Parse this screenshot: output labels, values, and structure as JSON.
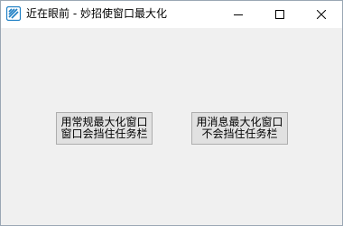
{
  "window": {
    "title": "近在眼前 - 妙招使窗口最大化",
    "app_icon": "app-icon",
    "controls": {
      "minimize_icon": "minimize-icon",
      "maximize_icon": "maximize-icon",
      "close_icon": "close-icon"
    }
  },
  "buttons": {
    "normal_maximize": {
      "line1": "用常规最大化窗口",
      "line2": "窗口会挡住任务栏"
    },
    "message_maximize": {
      "line1": "用消息最大化窗口",
      "line2": "不会挡住任务栏"
    }
  },
  "colors": {
    "titlebar": "#ffffff",
    "client_background": "#f0f0f0",
    "button_face": "#e1e1e1",
    "button_border": "#adadad",
    "icon_accent": "#1e7fc4"
  }
}
